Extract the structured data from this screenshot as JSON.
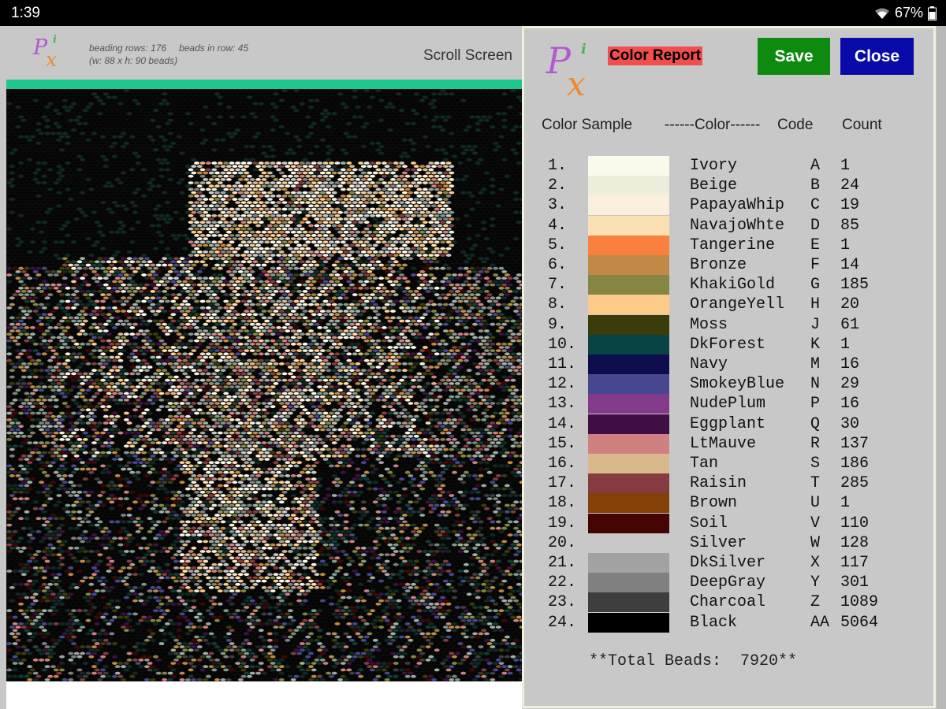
{
  "status_bar": {
    "time": "1:39",
    "battery": "67%"
  },
  "header": {
    "logo": {
      "p": "P",
      "x": "x",
      "i": "i"
    },
    "beading_rows": "beading rows: 176",
    "beads_in_row": "beads in row: 45",
    "dims": "(w: 88  x  h: 90 beads)",
    "scroll_label": "Scroll Screen"
  },
  "dialog": {
    "title": "Color Report",
    "save_label": "Save",
    "close_label": "Close",
    "headers": {
      "sample": "Color Sample",
      "color": "------Color------",
      "code": "Code",
      "count": "Count"
    },
    "rows": [
      {
        "num": "1.",
        "name": "Ivory",
        "code": "A",
        "count": "1",
        "color": "#fbf9ea"
      },
      {
        "num": "2.",
        "name": "Beige",
        "code": "B",
        "count": "24",
        "color": "#efeddc"
      },
      {
        "num": "3.",
        "name": "PapayaWhip",
        "code": "C",
        "count": "19",
        "color": "#fbf0de"
      },
      {
        "num": "4.",
        "name": "NavajoWhte",
        "code": "D",
        "count": "85",
        "color": "#fbe0b2"
      },
      {
        "num": "5.",
        "name": "Tangerine",
        "code": "E",
        "count": "1",
        "color": "#fb7f3e"
      },
      {
        "num": "6.",
        "name": "Bronze",
        "code": "F",
        "count": "14",
        "color": "#c18846"
      },
      {
        "num": "7.",
        "name": "KhakiGold",
        "code": "G",
        "count": "185",
        "color": "#868644"
      },
      {
        "num": "8.",
        "name": "OrangeYell",
        "code": "H",
        "count": "20",
        "color": "#fdcb89"
      },
      {
        "num": "9.",
        "name": "Moss",
        "code": "J",
        "count": "61",
        "color": "#3c3c0b"
      },
      {
        "num": "10.",
        "name": "DkForest",
        "code": "K",
        "count": "1",
        "color": "#084444"
      },
      {
        "num": "11.",
        "name": "Navy",
        "code": "M",
        "count": "16",
        "color": "#0e0e4e"
      },
      {
        "num": "12.",
        "name": "SmokeyBlue",
        "code": "N",
        "count": "29",
        "color": "#474791"
      },
      {
        "num": "13.",
        "name": "NudePlum",
        "code": "P",
        "count": "16",
        "color": "#843a8a"
      },
      {
        "num": "14.",
        "name": "Eggplant",
        "code": "Q",
        "count": "30",
        "color": "#3e0e44"
      },
      {
        "num": "15.",
        "name": "LtMauve",
        "code": "R",
        "count": "137",
        "color": "#d08080"
      },
      {
        "num": "16.",
        "name": "Tan",
        "code": "S",
        "count": "186",
        "color": "#dab88e"
      },
      {
        "num": "17.",
        "name": "Raisin",
        "code": "T",
        "count": "285",
        "color": "#843c40"
      },
      {
        "num": "18.",
        "name": "Brown",
        "code": "U",
        "count": "1",
        "color": "#844006"
      },
      {
        "num": "19.",
        "name": "Soil",
        "code": "V",
        "count": "110",
        "color": "#440404"
      },
      {
        "num": "20.",
        "name": "Silver",
        "code": "W",
        "count": "128",
        "color": "#c8c8c8"
      },
      {
        "num": "21.",
        "name": "DkSilver",
        "code": "X",
        "count": "117",
        "color": "#a2a2a2"
      },
      {
        "num": "22.",
        "name": "DeepGray",
        "code": "Y",
        "count": "301",
        "color": "#808080"
      },
      {
        "num": "23.",
        "name": "Charcoal",
        "code": "Z",
        "count": "1089",
        "color": "#3e3e3e"
      },
      {
        "num": "24.",
        "name": "Black",
        "code": "AA",
        "count": "5064",
        "color": "#000000"
      }
    ],
    "total": "**Total Beads:  7920**"
  }
}
